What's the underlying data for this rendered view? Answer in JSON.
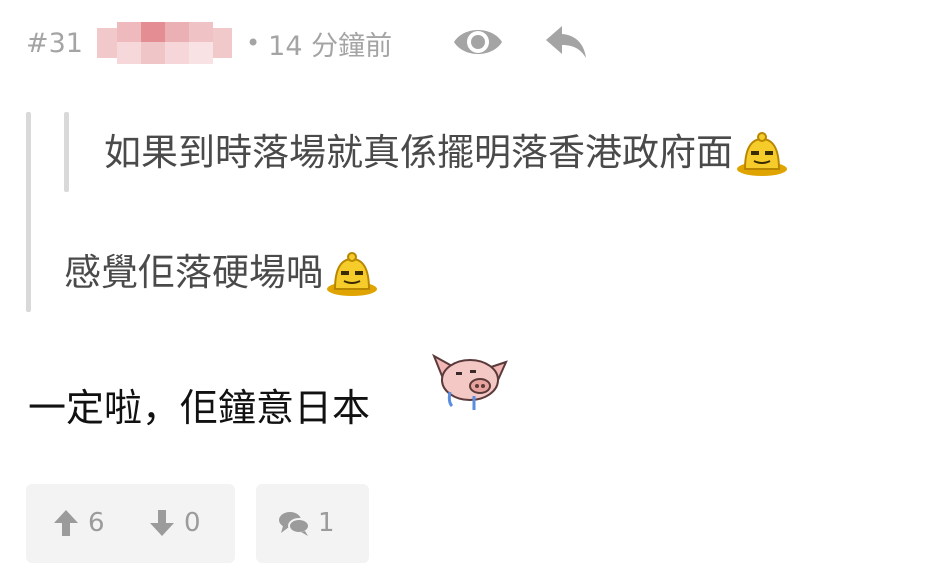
{
  "post": {
    "number": "#31",
    "separator": "•",
    "time": "14 分鐘前",
    "icons": {
      "view": "eye-icon",
      "reply": "reply-icon"
    }
  },
  "quotes": {
    "inner_text": "如果到時落場就真係擺明落香港政府面",
    "outer_text": "感覺佢落硬場喎"
  },
  "reply_text": "一定啦，佢鐘意日本",
  "reactions": {
    "upvotes": "6",
    "downvotes": "0",
    "comments": "1"
  },
  "colors": {
    "muted_text": "#9b9b9b",
    "quote_bar": "#d9d9d9",
    "button_bg": "#f3f3f3"
  }
}
